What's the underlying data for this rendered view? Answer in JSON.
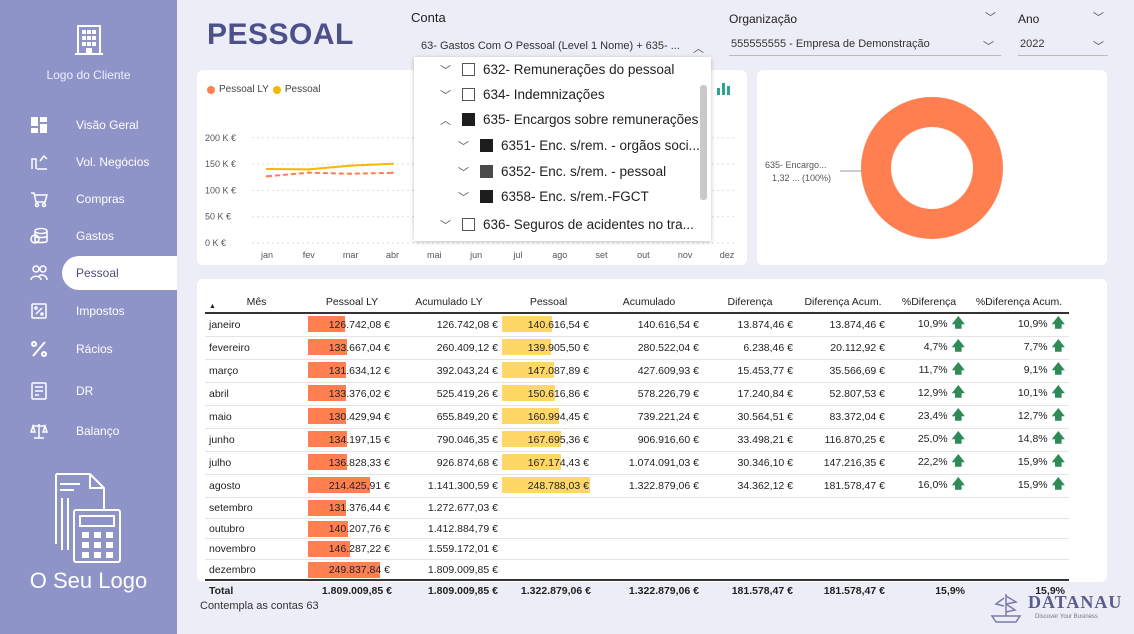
{
  "sidebar": {
    "client_logo_label": "Logo do Cliente",
    "items": [
      {
        "label": "Visão Geral",
        "icon": "grid-icon"
      },
      {
        "label": "Vol. Negócios",
        "icon": "chart-up-icon"
      },
      {
        "label": "Compras",
        "icon": "cart-icon"
      },
      {
        "label": "Gastos",
        "icon": "coins-icon"
      },
      {
        "label": "Pessoal",
        "icon": "people-icon"
      },
      {
        "label": "Impostos",
        "icon": "tax-icon"
      },
      {
        "label": "Rácios",
        "icon": "percent-icon"
      },
      {
        "label": "DR",
        "icon": "report-icon"
      },
      {
        "label": "Balanço",
        "icon": "scale-icon"
      }
    ],
    "active": "Pessoal",
    "bottom_logo_label": "O Seu Logo"
  },
  "header": {
    "title": "PESSOAL",
    "conta_label": "Conta",
    "conta_value": "63- Gastos Com O Pessoal (Level 1 Nome) + 635- ...",
    "org_label": "Organização",
    "org_value": "555555555 - Empresa de Demonstração",
    "ano_label": "Ano",
    "ano_value": "2022"
  },
  "dropdown": {
    "items": [
      {
        "label": "632- Remunerações do pessoal",
        "checked": false
      },
      {
        "label": "634- Indemnizações",
        "checked": false
      },
      {
        "label": "635- Encargos sobre remunerações",
        "checked": true
      },
      {
        "label": "6351- Enc. s/rem. - orgãos soci...",
        "checked": true
      },
      {
        "label": "6352- Enc. s/rem. - pessoal",
        "checked": true
      },
      {
        "label": "6358- Enc. s/rem.-FGCT",
        "checked": true
      },
      {
        "label": "636- Seguros de acidentes no tra...",
        "checked": false
      }
    ]
  },
  "chart_data": [
    {
      "type": "line",
      "legend": [
        "Pessoal LY",
        "Pessoal"
      ],
      "x": [
        "jan",
        "fev",
        "mar",
        "abr",
        "mai",
        "jun",
        "jul",
        "ago",
        "set",
        "out",
        "nov",
        "dez"
      ],
      "y_ticks": [
        "200 K €",
        "150 K €",
        "100 K €",
        "50 K €",
        "0 K €"
      ],
      "ylim": [
        0,
        250000
      ],
      "series": [
        {
          "name": "Pessoal LY",
          "color": "#ff7f50",
          "values": [
            126742.08,
            133667.04,
            131634.12,
            133376.02
          ]
        },
        {
          "name": "Pessoal",
          "color": "#f5b800",
          "values": [
            140616.54,
            139905.5,
            147087.89,
            150616.86
          ]
        }
      ]
    },
    {
      "type": "pie",
      "slices": [
        {
          "label": "635- Encargo...",
          "value_label": "1,32 ... (100%)",
          "share": 1.0,
          "color": "#ff7f50"
        }
      ]
    }
  ],
  "table": {
    "columns": [
      "Mês",
      "Pessoal LY",
      "Acumulado LY",
      "Pessoal",
      "Acumulado",
      "Diferença",
      "Diferença Acum.",
      "%Diferença",
      "%Diferença Acum."
    ],
    "pessoal_ly_max": 249837.84,
    "pessoal_max": 248788.03,
    "rows": [
      {
        "mes": "janeiro",
        "ly": "126.742,08 €",
        "ly_v": 126742.08,
        "acum_ly": "126.742,08 €",
        "p": "140.616,54 €",
        "p_v": 140616.54,
        "acum": "140.616,54 €",
        "dif": "13.874,46 €",
        "dif_acum": "13.874,46 €",
        "pct": "10,9%",
        "pct_acum": "10,9%"
      },
      {
        "mes": "fevereiro",
        "ly": "133.667,04 €",
        "ly_v": 133667.04,
        "acum_ly": "260.409,12 €",
        "p": "139.905,50 €",
        "p_v": 139905.5,
        "acum": "280.522,04 €",
        "dif": "6.238,46 €",
        "dif_acum": "20.112,92 €",
        "pct": "4,7%",
        "pct_acum": "7,7%"
      },
      {
        "mes": "março",
        "ly": "131.634,12 €",
        "ly_v": 131634.12,
        "acum_ly": "392.043,24 €",
        "p": "147.087,89 €",
        "p_v": 147087.89,
        "acum": "427.609,93 €",
        "dif": "15.453,77 €",
        "dif_acum": "35.566,69 €",
        "pct": "11,7%",
        "pct_acum": "9,1%"
      },
      {
        "mes": "abril",
        "ly": "133.376,02 €",
        "ly_v": 133376.02,
        "acum_ly": "525.419,26 €",
        "p": "150.616,86 €",
        "p_v": 150616.86,
        "acum": "578.226,79 €",
        "dif": "17.240,84 €",
        "dif_acum": "52.807,53 €",
        "pct": "12,9%",
        "pct_acum": "10,1%"
      },
      {
        "mes": "maio",
        "ly": "130.429,94 €",
        "ly_v": 130429.94,
        "acum_ly": "655.849,20 €",
        "p": "160.994,45 €",
        "p_v": 160994.45,
        "acum": "739.221,24 €",
        "dif": "30.564,51 €",
        "dif_acum": "83.372,04 €",
        "pct": "23,4%",
        "pct_acum": "12,7%"
      },
      {
        "mes": "junho",
        "ly": "134.197,15 €",
        "ly_v": 134197.15,
        "acum_ly": "790.046,35 €",
        "p": "167.695,36 €",
        "p_v": 167695.36,
        "acum": "906.916,60 €",
        "dif": "33.498,21 €",
        "dif_acum": "116.870,25 €",
        "pct": "25,0%",
        "pct_acum": "14,8%"
      },
      {
        "mes": "julho",
        "ly": "136.828,33 €",
        "ly_v": 136828.33,
        "acum_ly": "926.874,68 €",
        "p": "167.174,43 €",
        "p_v": 167174.43,
        "acum": "1.074.091,03 €",
        "dif": "30.346,10 €",
        "dif_acum": "147.216,35 €",
        "pct": "22,2%",
        "pct_acum": "15,9%"
      },
      {
        "mes": "agosto",
        "ly": "214.425,91 €",
        "ly_v": 214425.91,
        "acum_ly": "1.141.300,59 €",
        "p": "248.788,03 €",
        "p_v": 248788.03,
        "acum": "1.322.879,06 €",
        "dif": "34.362,12 €",
        "dif_acum": "181.578,47 €",
        "pct": "16,0%",
        "pct_acum": "15,9%"
      },
      {
        "mes": "setembro",
        "ly": "131.376,44 €",
        "ly_v": 131376.44,
        "acum_ly": "1.272.677,03 €",
        "p": "",
        "p_v": 0,
        "acum": "",
        "dif": "",
        "dif_acum": "",
        "pct": "",
        "pct_acum": ""
      },
      {
        "mes": "outubro",
        "ly": "140.207,76 €",
        "ly_v": 140207.76,
        "acum_ly": "1.412.884,79 €",
        "p": "",
        "p_v": 0,
        "acum": "",
        "dif": "",
        "dif_acum": "",
        "pct": "",
        "pct_acum": ""
      },
      {
        "mes": "novembro",
        "ly": "146.287,22 €",
        "ly_v": 146287.22,
        "acum_ly": "1.559.172,01 €",
        "p": "",
        "p_v": 0,
        "acum": "",
        "dif": "",
        "dif_acum": "",
        "pct": "",
        "pct_acum": ""
      },
      {
        "mes": "dezembro",
        "ly": "249.837,84 €",
        "ly_v": 249837.84,
        "acum_ly": "1.809.009,85 €",
        "p": "",
        "p_v": 0,
        "acum": "",
        "dif": "",
        "dif_acum": "",
        "pct": "",
        "pct_acum": ""
      }
    ],
    "total": {
      "mes": "Total",
      "ly": "1.809.009,85 €",
      "acum_ly": "1.809.009,85 €",
      "p": "1.322.879,06 €",
      "acum": "1.322.879,06 €",
      "dif": "181.578,47 €",
      "dif_acum": "181.578,47 €",
      "pct": "15,9%",
      "pct_acum": "15,9%"
    },
    "colors": {
      "ly_bar": "#ff7f50",
      "p_bar": "#ffd766",
      "up_arrow": "#2e8b57"
    }
  },
  "footnote": "Contempla as contas 63",
  "brand": {
    "name": "DATANAU",
    "tagline": "Discover Your Business"
  }
}
